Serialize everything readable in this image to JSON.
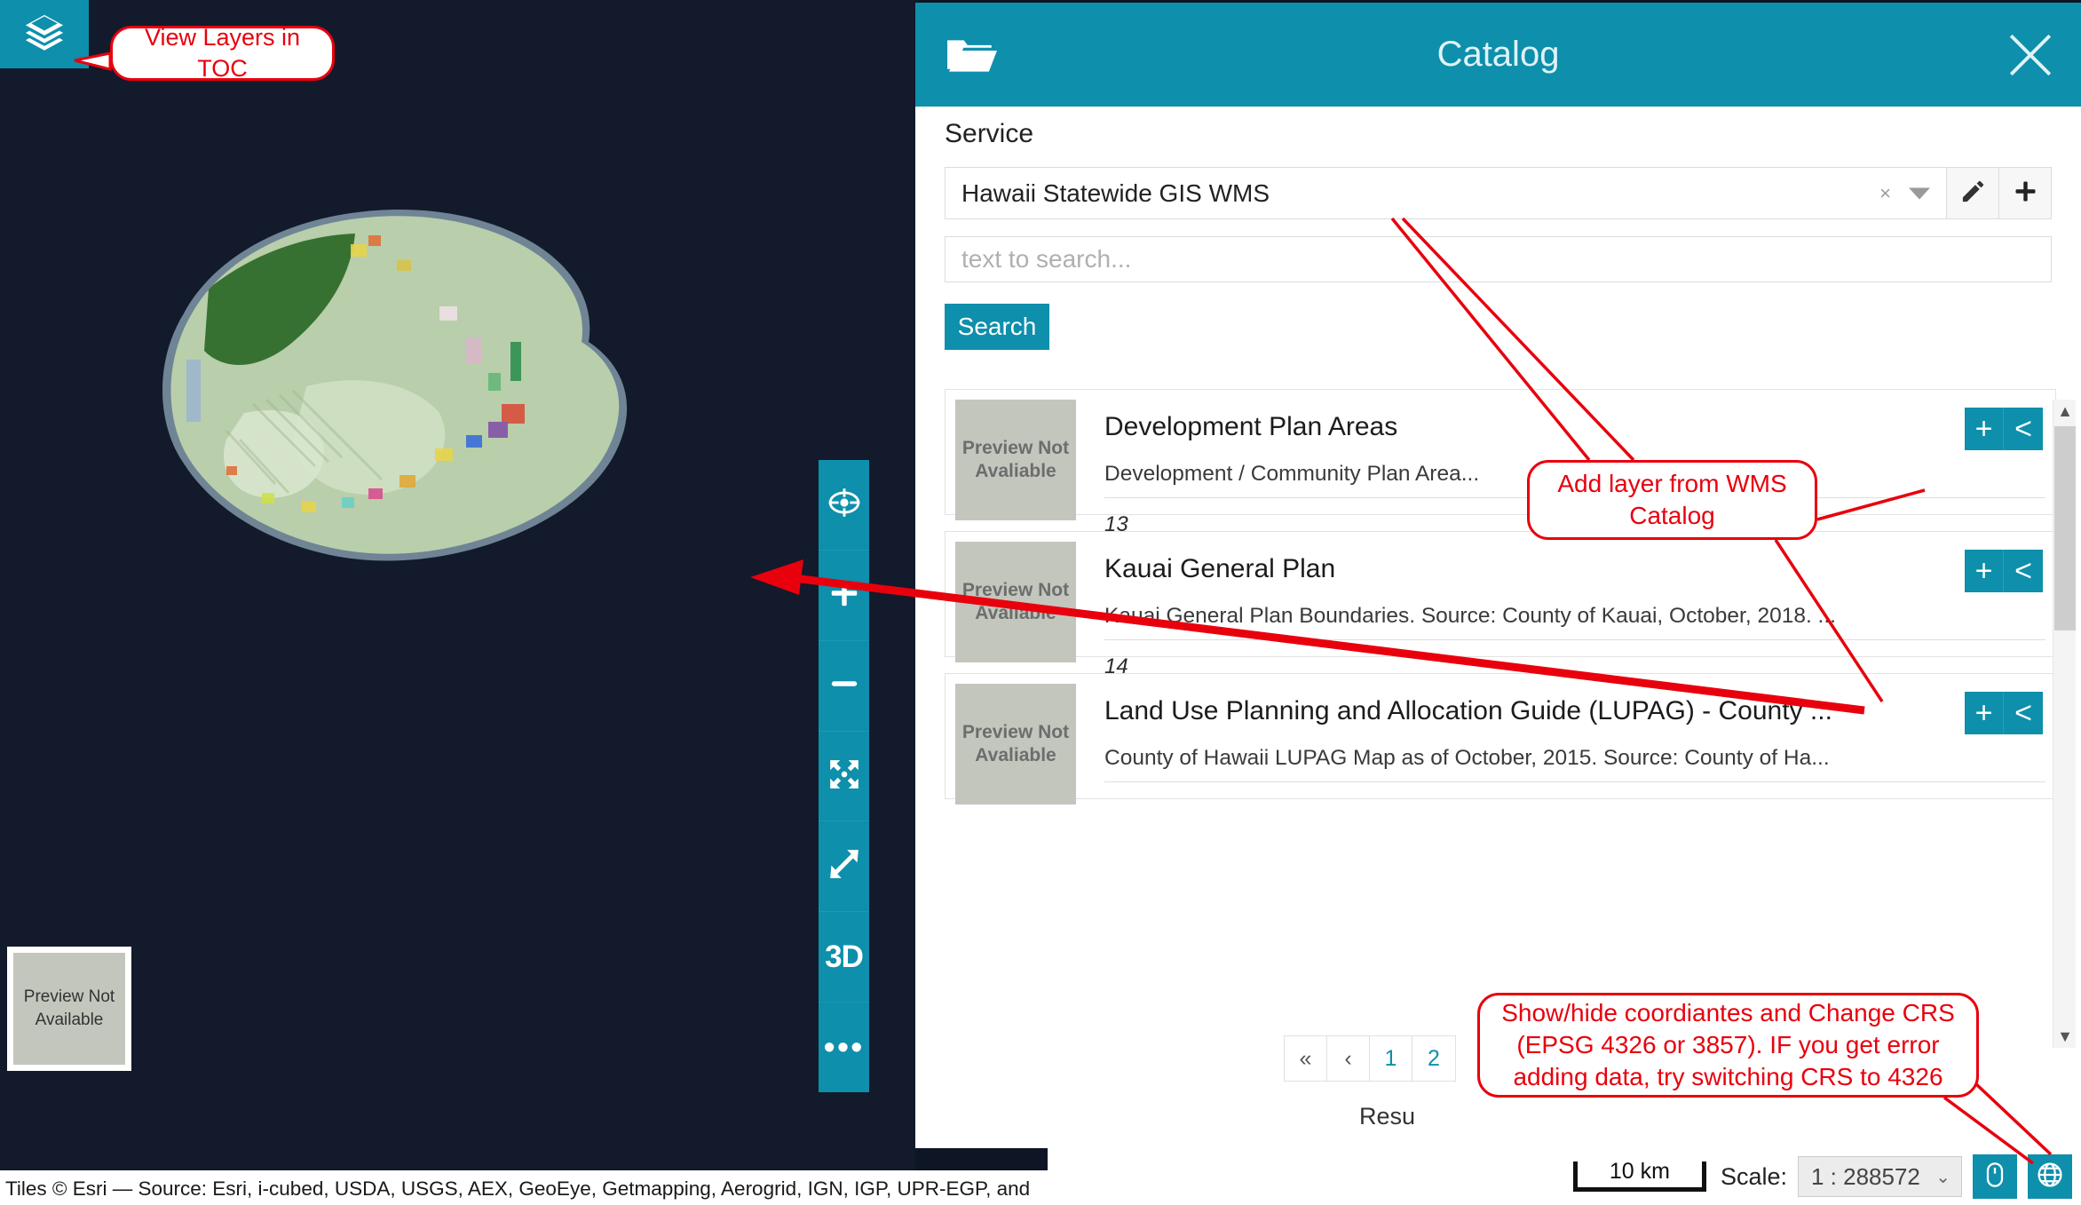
{
  "map": {
    "layers_button": "layers-icon",
    "toolbar": [
      {
        "name": "locate",
        "glyph": "crosshair-icon"
      },
      {
        "name": "zoom-in",
        "glyph": "plus-icon"
      },
      {
        "name": "zoom-out",
        "glyph": "minus-icon"
      },
      {
        "name": "zoom-to-extent",
        "glyph": "expand-arrows-icon"
      },
      {
        "name": "fullscreen",
        "glyph": "diagonal-arrows-icon"
      },
      {
        "name": "three-d",
        "glyph": "3D"
      },
      {
        "name": "more-options",
        "glyph": "•••"
      }
    ],
    "overview_preview": "Preview Not Available",
    "attribution": "Tiles © Esri — Source: Esri, i-cubed, USDA, USGS, AEX, GeoEye, Getmapping, Aerogrid, IGN, IGP, UPR-EGP, and\nthe GIS User Community"
  },
  "catalog": {
    "title": "Catalog",
    "folder_icon": "folder-open-icon",
    "close_icon": "close-icon",
    "service": {
      "label": "Service",
      "value": "Hawaii Statewide GIS WMS",
      "clear_glyph": "×",
      "edit_icon": "pencil-icon",
      "add_icon": "plus-icon"
    },
    "search": {
      "placeholder": "text to search...",
      "button_label": "Search"
    },
    "results": [
      {
        "thumb_text": "Preview Not Avaliable",
        "title": "Development Plan Areas",
        "description": "Development / Community Plan Area...",
        "id": "13",
        "add_label": "+",
        "expand_label": "<"
      },
      {
        "thumb_text": "Preview Not Avaliable",
        "title": "Kauai General Plan",
        "description": "Kauai General Plan Boundaries. Source: County of Kauai, October, 2018. ...",
        "id": "14",
        "add_label": "+",
        "expand_label": "<"
      },
      {
        "thumb_text": "Preview Not Avaliable",
        "title": "Land Use Planning and Allocation Guide (LUPAG) - County ...",
        "description": "County of Hawaii LUPAG Map as of October, 2015. Source: County of Ha...",
        "id": "",
        "add_label": "+",
        "expand_label": "<"
      }
    ],
    "pagination": [
      "«",
      "‹",
      "1",
      "2"
    ],
    "result_count_label": "Resu",
    "scrollbar": {
      "up": "▲",
      "down": "▼"
    }
  },
  "statusbar": {
    "scalebar_label": "10 km",
    "scale_label": "Scale:",
    "scale_value": "1 : 288572",
    "scale_caret": "⌄",
    "mouse_coords_icon": "mouse-icon",
    "crs_icon": "globe-icon"
  },
  "callouts": {
    "toc": "View Layers in TOC",
    "wms": "Add layer from WMS Catalog",
    "crs": "Show/hide coordiantes and Change CRS (EPSG 4326 or 3857). IF you get error adding data, try switching CRS to 4326"
  },
  "colors": {
    "accent": "#0e8fab",
    "callout": "#e8000d",
    "map_bg": "#121a2c"
  }
}
